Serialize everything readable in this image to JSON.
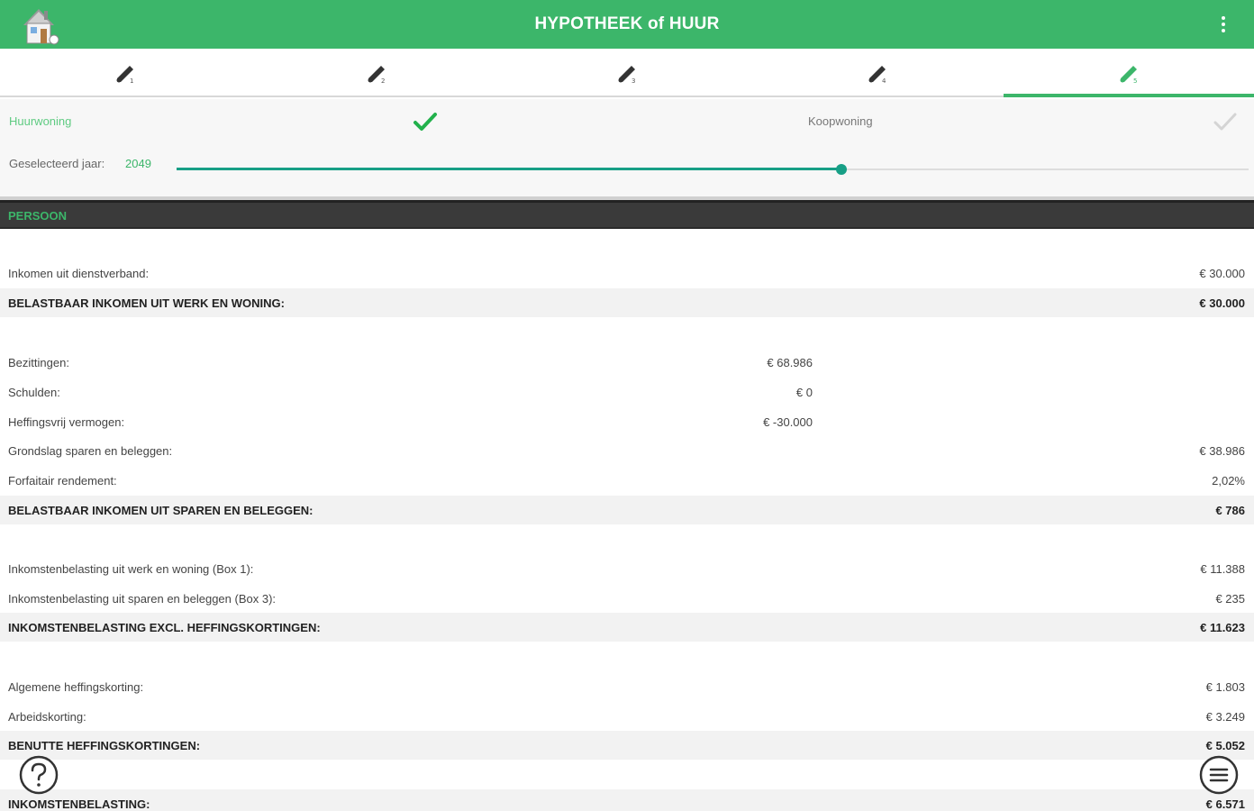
{
  "app": {
    "title": "HYPOTHEEK of HUUR",
    "logo_icon": "house-icon",
    "menu_icon": "more-vert-icon",
    "accent": "#3cb66a"
  },
  "tabs": [
    {
      "label": "1",
      "icon": "step-icon",
      "active": false
    },
    {
      "label": "2",
      "icon": "step-icon",
      "active": false
    },
    {
      "label": "3",
      "icon": "step-icon",
      "active": false
    },
    {
      "label": "4",
      "icon": "step-icon",
      "active": false
    },
    {
      "label": "5",
      "icon": "step-icon",
      "active": true
    }
  ],
  "filters": {
    "huur_label": "Huurwoning",
    "huur_checked": true,
    "koop_label": "Koopwoning",
    "koop_checked": false,
    "year_label": "Geselecteerd jaar:",
    "year_value": "2049",
    "slider_fraction": 0.62
  },
  "section": {
    "title": "PERSOON"
  },
  "rows": [
    {
      "label": "Inkomen uit dienstverband:",
      "value": "€ 30.000",
      "total": false
    },
    {
      "label": "BELASTBAAR INKOMEN UIT WERK EN WONING:",
      "value": "€ 30.000",
      "total": true
    },
    {
      "label": "Bezittingen:",
      "mid": "€ 68.986",
      "total": false
    },
    {
      "label": "Schulden:",
      "mid": "€ 0",
      "total": false
    },
    {
      "label": "Heffingsvrij vermogen:",
      "mid": "€ -30.000",
      "total": false
    },
    {
      "label": "Grondslag sparen en beleggen:",
      "value": "€ 38.986",
      "total": false
    },
    {
      "label": "Forfaitair rendement:",
      "value": "2,02%",
      "total": false
    },
    {
      "label": "BELASTBAAR INKOMEN UIT SPAREN EN BELEGGEN:",
      "value": "€ 786",
      "total": true
    },
    {
      "label": "Inkomstenbelasting uit werk en woning (Box 1):",
      "value": "€ 11.388",
      "total": false
    },
    {
      "label": "Inkomstenbelasting uit sparen en beleggen (Box 3):",
      "value": "€ 235",
      "total": false
    },
    {
      "label": "INKOMSTENBELASTING EXCL. HEFFINGSKORTINGEN:",
      "value": "€ 11.623",
      "total": true
    },
    {
      "label": "Algemene heffingskorting:",
      "value": "€ 1.803",
      "total": false
    },
    {
      "label": "Arbeidskorting:",
      "value": "€ 3.249",
      "total": false
    },
    {
      "label": "BENUTTE HEFFINGSKORTINGEN:",
      "value": "€ 5.052",
      "total": true
    },
    {
      "label": "INKOMSTENBELASTING:",
      "value": "€ 6.571",
      "total": true
    }
  ],
  "fabs": {
    "help_icon": "help-icon",
    "menu_icon": "list-menu-icon"
  }
}
